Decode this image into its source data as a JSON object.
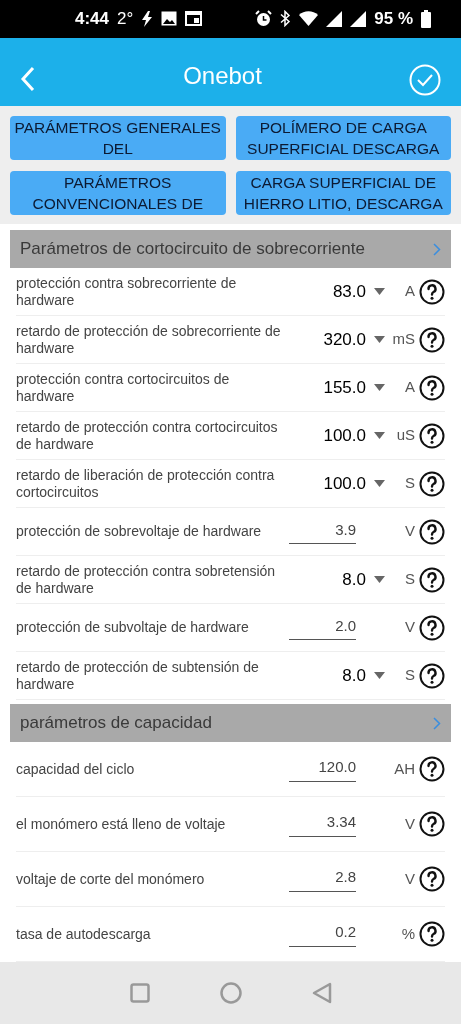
{
  "status_bar": {
    "time": "4:44",
    "temperature": "2°",
    "battery": "95 %"
  },
  "header": {
    "title": "Onebot"
  },
  "category_buttons": [
    "PARÁMETROS GENERALES DEL",
    "POLÍMERO DE CARGA SUPERFICIAL DESCARGA",
    "PARÁMETROS CONVENCIONALES DE",
    "CARGA SUPERFICIAL DE HIERRO LITIO, DESCARGA"
  ],
  "sections": [
    {
      "title": "Parámetros de cortocircuito de sobrecorriente",
      "rows": [
        {
          "kind": "dropdown",
          "label": "protección contra sobrecorriente de hardware",
          "value": "83.0",
          "unit": "A"
        },
        {
          "kind": "dropdown",
          "label": "retardo de protección de sobrecorriente de hardware",
          "value": "320.0",
          "unit": "mS"
        },
        {
          "kind": "dropdown",
          "label": "protección contra cortocircuitos de hardware",
          "value": "155.0",
          "unit": "A"
        },
        {
          "kind": "dropdown",
          "label": "retardo de protección contra cortocircuitos de hardware",
          "value": "100.0",
          "unit": "uS"
        },
        {
          "kind": "dropdown",
          "label": "retardo de liberación de protección contra cortocircuitos",
          "value": "100.0",
          "unit": "S"
        },
        {
          "kind": "field",
          "label": "protección de sobrevoltaje de hardware",
          "value": "3.9",
          "unit": "V"
        },
        {
          "kind": "dropdown",
          "label": "retardo de protección contra sobretensión de hardware",
          "value": "8.0",
          "unit": "S"
        },
        {
          "kind": "field",
          "label": "protección de subvoltaje de hardware",
          "value": "2.0",
          "unit": "V"
        },
        {
          "kind": "dropdown",
          "label": "retardo de protección de subtensión de hardware",
          "value": "8.0",
          "unit": "S"
        }
      ]
    },
    {
      "title": "parámetros de capacidad",
      "rows": [
        {
          "kind": "field",
          "label": "capacidad del ciclo",
          "value": "120.0",
          "unit": "AH"
        },
        {
          "kind": "field",
          "label": "el monómero está lleno de voltaje",
          "value": "3.34",
          "unit": "V"
        },
        {
          "kind": "field",
          "label": "voltaje de corte del monómero",
          "value": "2.8",
          "unit": "V"
        },
        {
          "kind": "field",
          "label": "tasa de autodescarga",
          "value": "0.2",
          "unit": "%"
        }
      ]
    }
  ]
}
